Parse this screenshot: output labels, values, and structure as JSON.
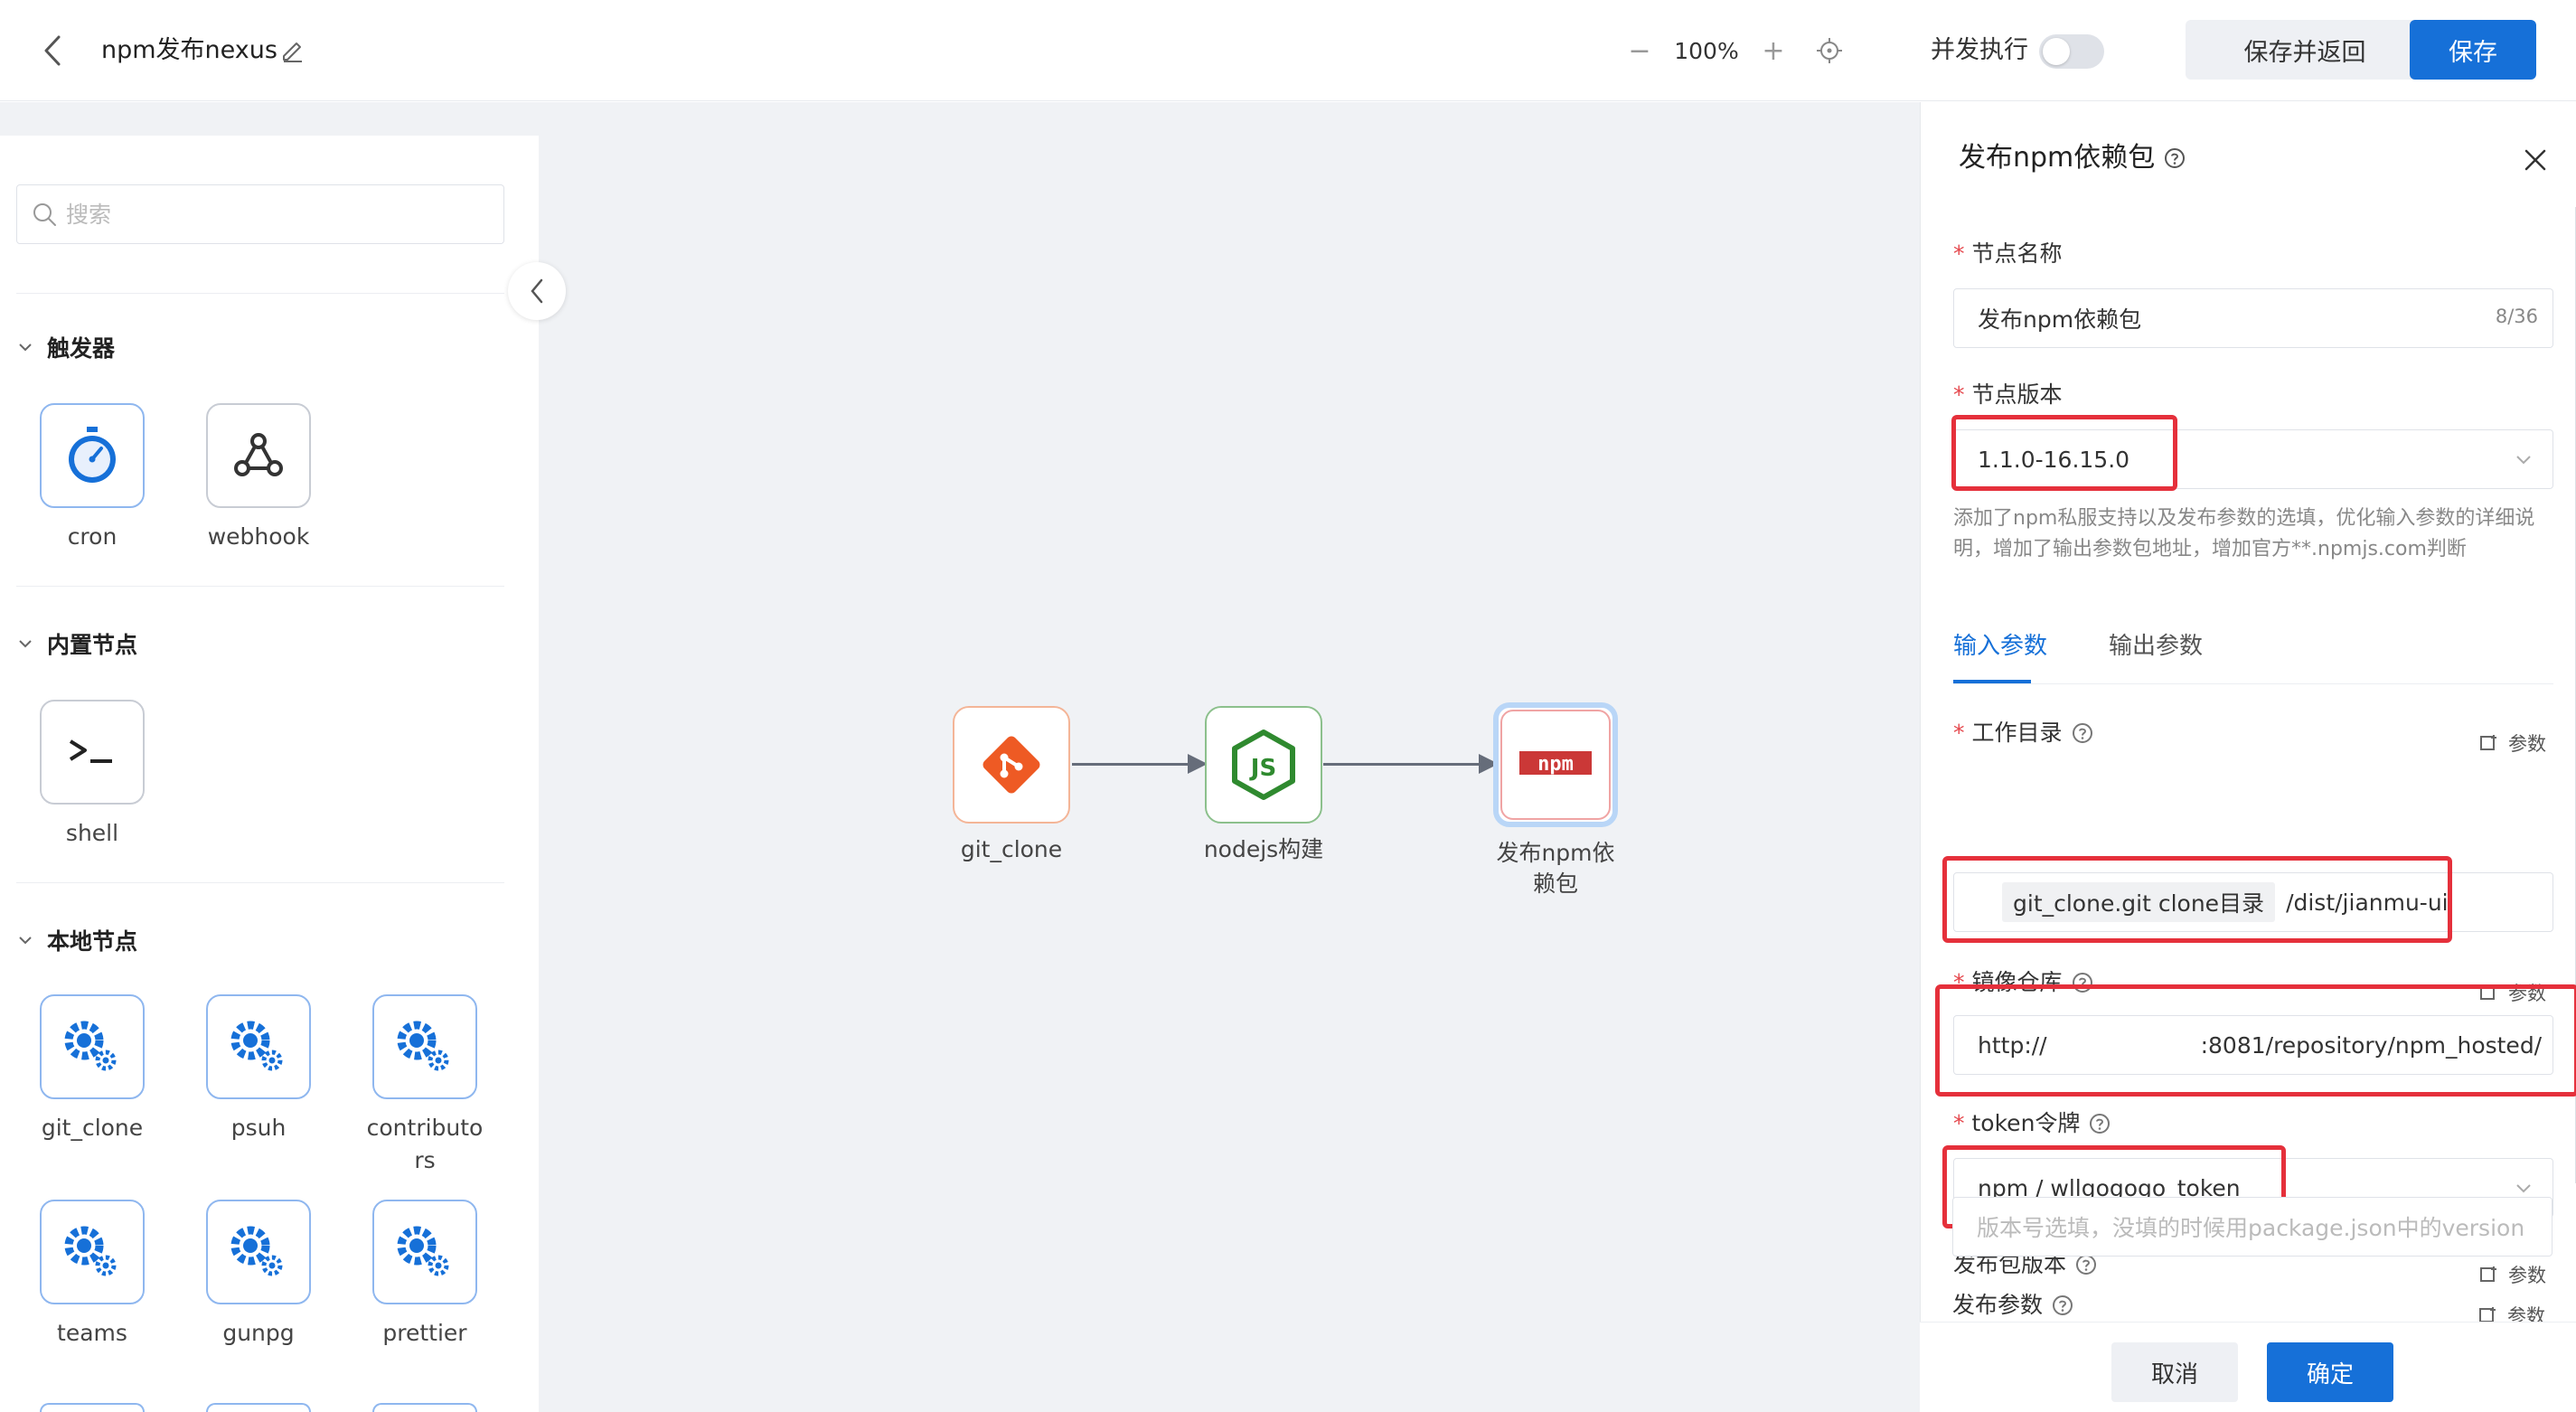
{
  "header": {
    "title": "npm发布nexus",
    "zoom": "100%",
    "zoom_out_symbol": "−",
    "zoom_in_symbol": "+",
    "concurrent_label": "并发执行",
    "concurrent_enabled": false,
    "save_return_label": "保存并返回",
    "save_label": "保存"
  },
  "left_panel": {
    "search_placeholder": "搜索",
    "sections": [
      {
        "title": "触发器",
        "items": [
          {
            "label": "cron",
            "icon": "stopwatch-icon"
          },
          {
            "label": "webhook",
            "icon": "webhook-icon"
          }
        ]
      },
      {
        "title": "内置节点",
        "items": [
          {
            "label": "shell",
            "icon": "terminal-icon"
          }
        ]
      },
      {
        "title": "本地节点",
        "items": [
          {
            "label": "git_clone",
            "icon": "gears-icon"
          },
          {
            "label": "psuh",
            "icon": "gears-icon"
          },
          {
            "label": "contributors",
            "icon": "gears-icon"
          },
          {
            "label": "teams",
            "icon": "gears-icon"
          },
          {
            "label": "gunpg",
            "icon": "gears-icon"
          },
          {
            "label": "prettier",
            "icon": "gears-icon"
          }
        ]
      }
    ]
  },
  "flow": {
    "nodes": [
      {
        "label": "git_clone",
        "icon": "git-icon"
      },
      {
        "label": "nodejs构建",
        "icon": "nodejs-icon"
      },
      {
        "label": "发布npm依赖包",
        "icon": "npm-icon"
      }
    ]
  },
  "drawer": {
    "title": "发布npm依赖包",
    "fields": {
      "node_name": {
        "label": "节点名称",
        "value": "发布npm依赖包",
        "count": "8/36"
      },
      "node_version": {
        "label": "节点版本",
        "value": "1.1.0-16.15.0"
      },
      "version_desc": "添加了npm私服支持以及发布参数的选填，优化输入参数的详细说明，增加了输出参数包地址，增加官方**.npmjs.com判断",
      "work_dir": {
        "label": "工作目录",
        "chip": "git_clone.git clone目录",
        "value": "/dist/jianmu-ui"
      },
      "registry": {
        "label": "镜像仓库",
        "value_prefix": "http://",
        "value_suffix": ":8081/repository/npm_hosted/"
      },
      "token": {
        "label": "token令牌",
        "value": "npm / wllgogogo_token"
      },
      "publish_version": {
        "label": "发布包版本",
        "placeholder": "版本号选填，没填的时候用package.json中的version"
      },
      "publish_params": {
        "label": "发布参数"
      }
    },
    "param_link": "参数",
    "tabs": [
      "输入参数",
      "输出参数"
    ],
    "cancel_label": "取消",
    "confirm_label": "确定"
  },
  "colors": {
    "primary": "#1670d8",
    "highlight_red": "#e5303b",
    "required_red": "#e5484d",
    "canvas_bg": "#f0f2f5"
  }
}
